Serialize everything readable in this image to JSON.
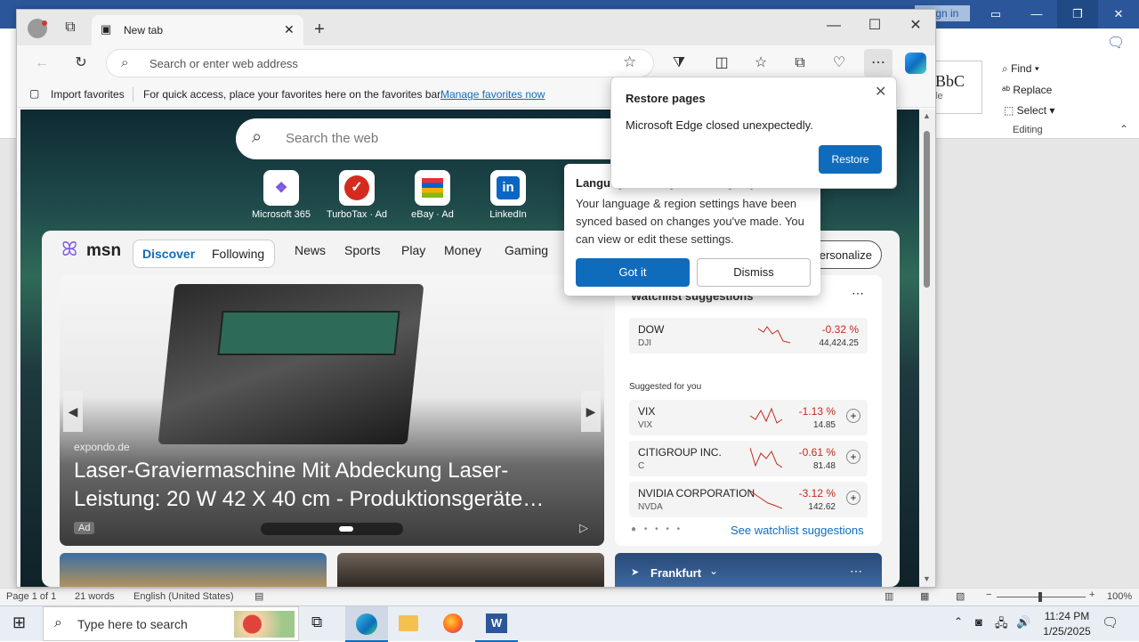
{
  "word": {
    "signin": "Sign in",
    "style_preview": "BbC",
    "style_sub": "le",
    "find": "Find",
    "replace": "Replace",
    "select": "Select",
    "editing_group": "Editing",
    "status_page": "Page 1 of 1",
    "status_words": "21 words",
    "status_lang": "English (United States)",
    "zoom": "100%"
  },
  "edge": {
    "tab_title": "New tab",
    "address_placeholder": "Search or enter web address",
    "fav_import": "Import favorites",
    "fav_hint": "For quick access, place your favorites here on the favorites bar.",
    "fav_manage": "Manage favorites now"
  },
  "ntp": {
    "search_placeholder": "Search the web",
    "quicklinks": [
      {
        "label": "Microsoft 365",
        "icon": "microsoft-365-icon"
      },
      {
        "label": "TurboTax · Ad",
        "icon": "turbotax-icon"
      },
      {
        "label": "eBay · Ad",
        "icon": "ebay-icon"
      },
      {
        "label": "LinkedIn",
        "icon": "linkedin-icon"
      }
    ],
    "msn_logo": "msn",
    "tabs": [
      "Discover",
      "Following"
    ],
    "nav": [
      "News",
      "Sports",
      "Play",
      "Money",
      "Gaming"
    ],
    "personalize": "Personalize",
    "hero": {
      "source": "expondo.de",
      "title": "Laser-Graviermaschine Mit Abdeckung Laser-Leistung: 20 W 42 X 40 cm - Produktionsgeräte…",
      "ad": "Ad"
    },
    "watchlist": {
      "title": "Watchlist suggestions",
      "suggested": "Suggested for you",
      "see_all": "See watchlist suggestions",
      "stocks": [
        {
          "name": "DOW",
          "ticker": "DJI",
          "change": "-0.32 %",
          "price": "44,424.25"
        },
        {
          "name": "VIX",
          "ticker": "VIX",
          "change": "-1.13 %",
          "price": "14.85"
        },
        {
          "name": "CITIGROUP INC.",
          "ticker": "C",
          "change": "-0.61 %",
          "price": "81.48"
        },
        {
          "name": "NVIDIA CORPORATION",
          "ticker": "NVDA",
          "change": "-3.12 %",
          "price": "142.62"
        }
      ]
    },
    "weather_city": "Frankfurt"
  },
  "restore_popup": {
    "title": "Restore pages",
    "message": "Microsoft Edge closed unexpectedly.",
    "button": "Restore"
  },
  "lang_popup": {
    "title": "Language and region settings synced",
    "message": "Your language & region settings have been synced based on changes you've made. You can view or edit these settings.",
    "got_it": "Got it",
    "dismiss": "Dismiss"
  },
  "taskbar": {
    "search_placeholder": "Type here to search",
    "time": "11:24 PM",
    "date": "1/25/2025"
  },
  "colors": {
    "accent": "#0f6cbd",
    "word_blue": "#2b579a",
    "negative": "#c42b1c"
  }
}
